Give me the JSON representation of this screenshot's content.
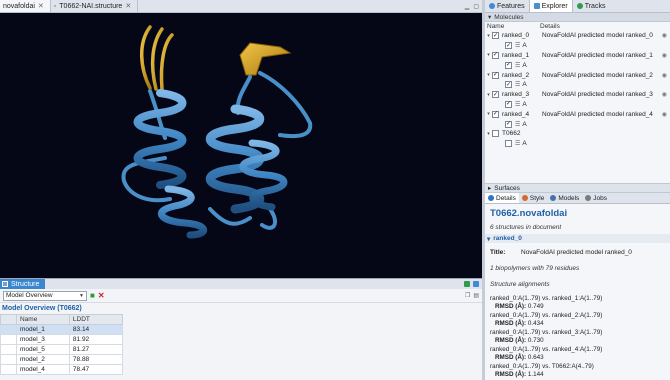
{
  "doc_tabs": [
    {
      "label": "novafoldai",
      "active": true
    },
    {
      "label": "T0662-NAI.structure",
      "active": false
    }
  ],
  "bottom_tabs": {
    "structure_label": "Structure"
  },
  "structure_panel": {
    "combo_value": "Model Overview",
    "overview_title": "Model Overview (T0662)",
    "columns": [
      "",
      "Name",
      "LDDT"
    ],
    "rows": [
      {
        "name": "model_1",
        "lddt": "83.14"
      },
      {
        "name": "model_3",
        "lddt": "81.92"
      },
      {
        "name": "model_5",
        "lddt": "81.27"
      },
      {
        "name": "model_2",
        "lddt": "78.88"
      },
      {
        "name": "model_4",
        "lddt": "78.47"
      }
    ]
  },
  "right_tabs": [
    {
      "label": "Features",
      "active": false,
      "color": "#3d8bd9"
    },
    {
      "label": "Explorer",
      "active": true,
      "color": "#4a90d0"
    },
    {
      "label": "Tracks",
      "active": false,
      "color": "#2e9b4f"
    }
  ],
  "molecules": {
    "section_title": "Molecules",
    "header_name": "Name",
    "header_details": "Details",
    "items": [
      {
        "name": "ranked_0",
        "details": "NovaFoldAI predicted model ranked_0",
        "checked": true,
        "chain": "A",
        "chain_checked": true
      },
      {
        "name": "ranked_1",
        "details": "NovaFoldAI predicted model ranked_1",
        "checked": true,
        "chain": "A",
        "chain_checked": true
      },
      {
        "name": "ranked_2",
        "details": "NovaFoldAI predicted model ranked_2",
        "checked": true,
        "chain": "A",
        "chain_checked": true
      },
      {
        "name": "ranked_3",
        "details": "NovaFoldAI predicted model ranked_3",
        "checked": true,
        "chain": "A",
        "chain_checked": true
      },
      {
        "name": "ranked_4",
        "details": "NovaFoldAI predicted model ranked_4",
        "checked": true,
        "chain": "A",
        "chain_checked": true
      },
      {
        "name": "T0662",
        "details": "",
        "checked": false,
        "chain": "A",
        "chain_checked": false
      }
    ]
  },
  "surfaces_label": "Surfaces",
  "details_tabs": [
    {
      "label": "Details",
      "active": true,
      "color": "#2e75c7"
    },
    {
      "label": "Style",
      "active": false,
      "color": "#d36a2a"
    },
    {
      "label": "Models",
      "active": false,
      "color": "#4b6fa8"
    },
    {
      "label": "Jobs",
      "active": false,
      "color": "#7b7b7b"
    }
  ],
  "details": {
    "title": "T0662.novafoldai",
    "subtitle": "6 structures in document",
    "section": "ranked_0",
    "field_title_key": "Title:",
    "field_title_value": "NovaFoldAI predicted model ranked_0",
    "biopolymers": "1 biopolymers with 79 residues",
    "alignments_heading": "Structure alignments",
    "rmsd_label": "RMSD (Å):",
    "alignments": [
      {
        "pair": "ranked_0:A(1..79) vs. ranked_1:A(1..79)",
        "rmsd": "0.749"
      },
      {
        "pair": "ranked_0:A(1..79) vs. ranked_2:A(1..79)",
        "rmsd": "0.434"
      },
      {
        "pair": "ranked_0:A(1..79) vs. ranked_3:A(1..79)",
        "rmsd": "0.730"
      },
      {
        "pair": "ranked_0:A(1..79) vs. ranked_4:A(1..79)",
        "rmsd": "0.643"
      },
      {
        "pair": "ranked_0:A(1..79) vs. T0662:A(4..79)",
        "rmsd": "1.144"
      }
    ]
  },
  "colors": {
    "helix": "#4a90c8",
    "strand": "#d9a521",
    "viewer_bg": "#050717",
    "accent": "#1f5fa6"
  }
}
